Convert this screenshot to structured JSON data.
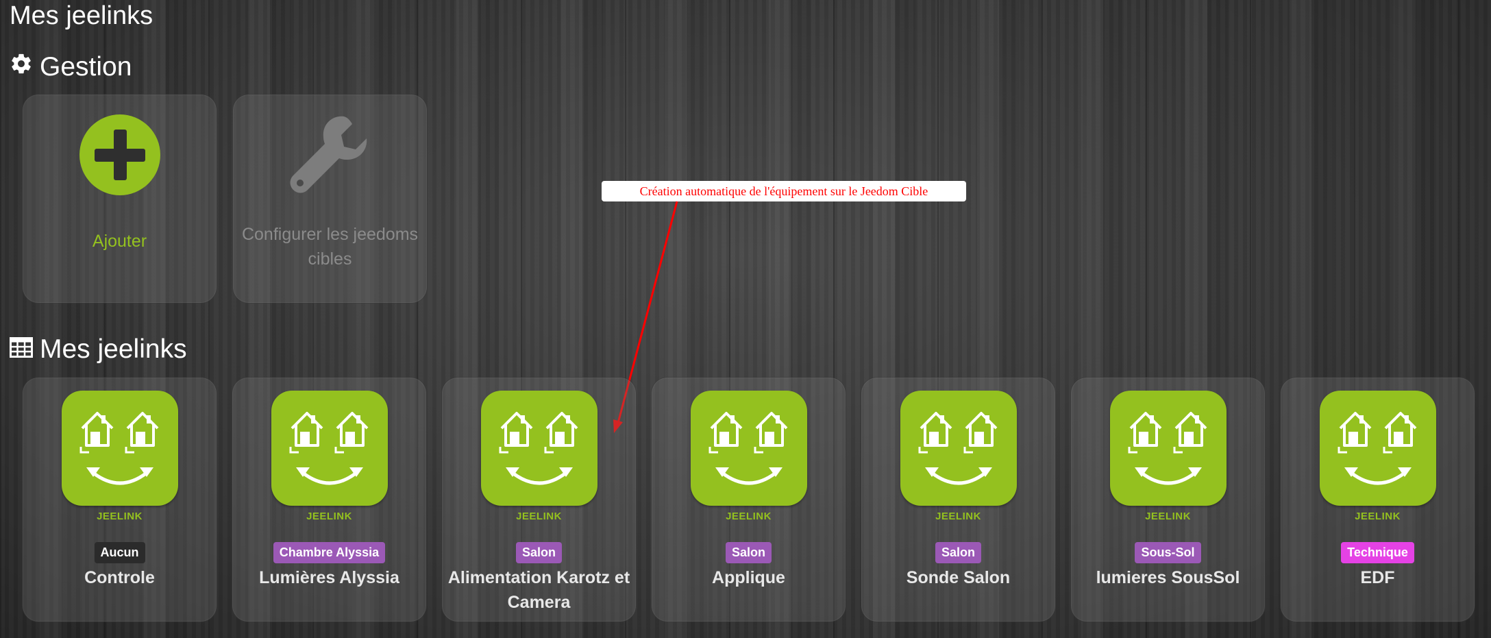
{
  "page": {
    "title": "Mes jeelinks"
  },
  "management": {
    "title": "Gestion",
    "icon": "gear-icon",
    "add_label": "Ajouter",
    "add_icon": "plus-circle-icon",
    "config_label": "Configurer les jeedoms cibles",
    "config_icon": "wrench-icon"
  },
  "equipments": {
    "title": "Mes jeelinks",
    "icon": "table-icon",
    "plugin_label": "JEELINK",
    "items": [
      {
        "object": "Aucun",
        "name": "Controle",
        "badge_color": "#2b2b2b"
      },
      {
        "object": "Chambre Alyssia",
        "name": "Lumières Alyssia",
        "badge_color": "#9b59b6"
      },
      {
        "object": "Salon",
        "name": "Alimentation Karotz et Camera",
        "badge_color": "#9b59b6"
      },
      {
        "object": "Salon",
        "name": "Applique",
        "badge_color": "#9b59b6"
      },
      {
        "object": "Salon",
        "name": "Sonde Salon",
        "badge_color": "#9b59b6"
      },
      {
        "object": "Sous-Sol",
        "name": "lumieres SousSol",
        "badge_color": "#9b59b6"
      },
      {
        "object": "Technique",
        "name": "EDF",
        "badge_color": "#e542e5"
      }
    ]
  },
  "annotation": {
    "text": "Création automatique de l'équipement sur le Jeedom Cible",
    "color": "#ff0000"
  },
  "colors": {
    "accent": "#94c11f",
    "muted": "#8b8b8b"
  }
}
